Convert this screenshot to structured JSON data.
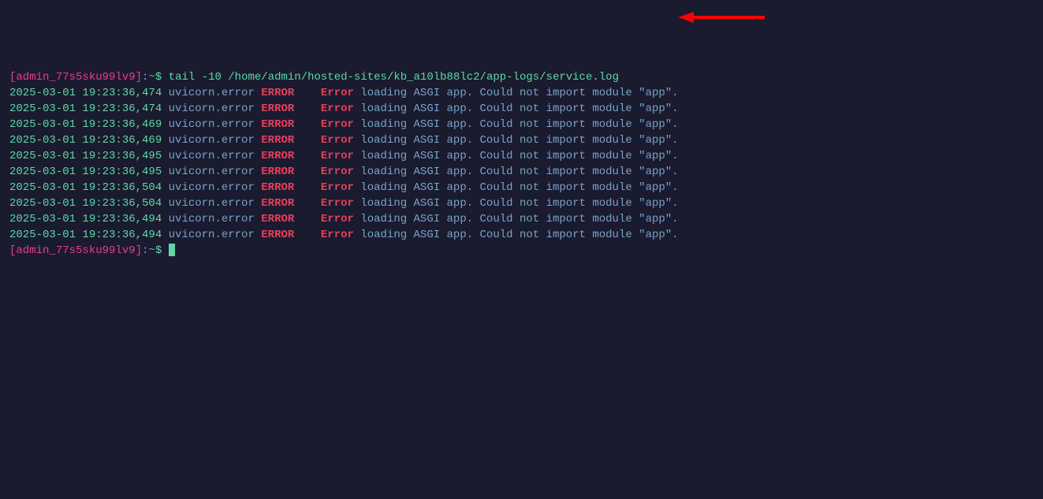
{
  "prompt": {
    "bracket_open": "[",
    "user_host": "admin_77s5sku99lv9",
    "bracket_close": "]",
    "separator": ":~",
    "dollar": "$"
  },
  "command": {
    "text": "tail -10 /home/admin/hosted-sites/kb_a10lb88lc2/app-logs/service.log"
  },
  "log_lines": [
    {
      "ts": "2025-03-01 19:23:36,474",
      "logger": "uvicorn.error",
      "level": "ERROR",
      "err": "Error",
      "msg": " loading ASGI app. Could not import module \"app\"."
    },
    {
      "ts": "2025-03-01 19:23:36,474",
      "logger": "uvicorn.error",
      "level": "ERROR",
      "err": "Error",
      "msg": " loading ASGI app. Could not import module \"app\"."
    },
    {
      "ts": "2025-03-01 19:23:36,469",
      "logger": "uvicorn.error",
      "level": "ERROR",
      "err": "Error",
      "msg": " loading ASGI app. Could not import module \"app\"."
    },
    {
      "ts": "2025-03-01 19:23:36,469",
      "logger": "uvicorn.error",
      "level": "ERROR",
      "err": "Error",
      "msg": " loading ASGI app. Could not import module \"app\"."
    },
    {
      "ts": "2025-03-01 19:23:36,495",
      "logger": "uvicorn.error",
      "level": "ERROR",
      "err": "Error",
      "msg": " loading ASGI app. Could not import module \"app\"."
    },
    {
      "ts": "2025-03-01 19:23:36,495",
      "logger": "uvicorn.error",
      "level": "ERROR",
      "err": "Error",
      "msg": " loading ASGI app. Could not import module \"app\"."
    },
    {
      "ts": "2025-03-01 19:23:36,504",
      "logger": "uvicorn.error",
      "level": "ERROR",
      "err": "Error",
      "msg": " loading ASGI app. Could not import module \"app\"."
    },
    {
      "ts": "2025-03-01 19:23:36,504",
      "logger": "uvicorn.error",
      "level": "ERROR",
      "err": "Error",
      "msg": " loading ASGI app. Could not import module \"app\"."
    },
    {
      "ts": "2025-03-01 19:23:36,494",
      "logger": "uvicorn.error",
      "level": "ERROR",
      "err": "Error",
      "msg": " loading ASGI app. Could not import module \"app\"."
    },
    {
      "ts": "2025-03-01 19:23:36,494",
      "logger": "uvicorn.error",
      "level": "ERROR",
      "err": "Error",
      "msg": " loading ASGI app. Could not import module \"app\"."
    }
  ],
  "annotation": {
    "arrow_color": "#ff0000"
  }
}
